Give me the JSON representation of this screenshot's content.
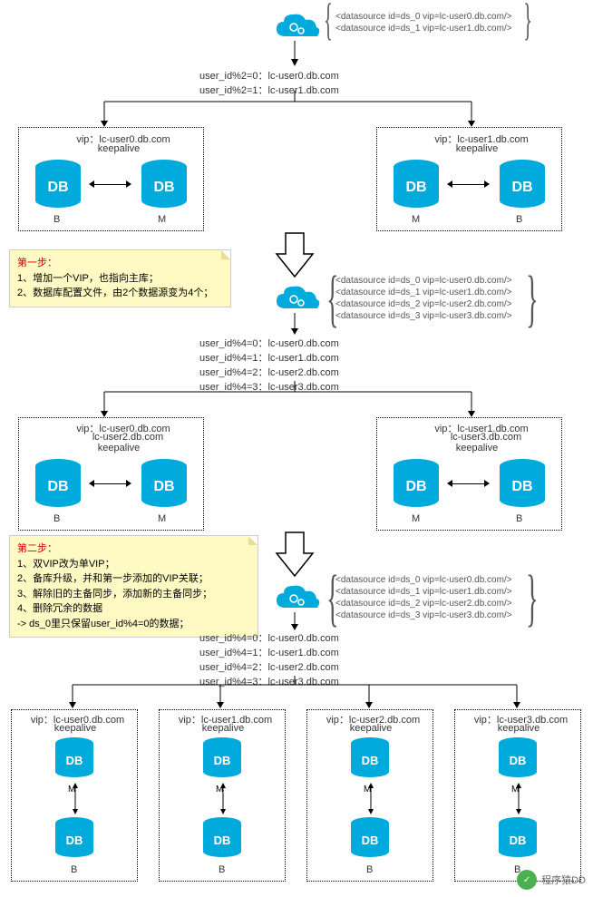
{
  "stage1": {
    "datasources": [
      "<datasource id=ds_0 vip=lc-user0.db.com/>",
      "<datasource id=ds_1 vip=lc-user1.db.com/>"
    ],
    "routing": [
      "user_id%2=0：lc-user0.db.com",
      "user_id%2=1：lc-user1.db.com"
    ],
    "leftBox": {
      "vip": "vip：lc-user0.db.com",
      "keepalive": "keepalive",
      "leftLabel": "B",
      "rightLabel": "M"
    },
    "rightBox": {
      "vip": "vip：lc-user1.db.com",
      "keepalive": "keepalive",
      "leftLabel": "M",
      "rightLabel": "B"
    }
  },
  "note1": {
    "title": "第一步：",
    "lines": [
      "1、增加一个VIP，也指向主库；",
      "2、数据库配置文件，由2个数据源变为4个；"
    ]
  },
  "stage2": {
    "datasources": [
      "<datasource id=ds_0 vip=lc-user0.db.com/>",
      "<datasource id=ds_1 vip=lc-user1.db.com/>",
      "<datasource id=ds_2 vip=lc-user2.db.com/>",
      "<datasource id=ds_3 vip=lc-user3.db.com/>"
    ],
    "routing": [
      "user_id%4=0：lc-user0.db.com",
      "user_id%4=1：lc-user1.db.com",
      "user_id%4=2：lc-user2.db.com",
      "user_id%4=3：lc-user3.db.com"
    ],
    "leftBox": {
      "vip1": "vip：lc-user0.db.com",
      "vip2": "lc-user2.db.com",
      "keepalive": "keepalive",
      "leftLabel": "B",
      "rightLabel": "M"
    },
    "rightBox": {
      "vip1": "vip：lc-user1.db.com",
      "vip2": "lc-user3.db.com",
      "keepalive": "keepalive",
      "leftLabel": "M",
      "rightLabel": "B"
    }
  },
  "note2": {
    "title": "第二步：",
    "lines": [
      "1、双VIP改为单VIP；",
      "2、备库升级，并和第一步添加的VIP关联；",
      "3、解除旧的主备同步，添加新的主备同步；",
      "4、删除冗余的数据",
      "     -> ds_0里只保留user_id%4=0的数据；"
    ]
  },
  "stage3": {
    "datasources": [
      "<datasource id=ds_0 vip=lc-user0.db.com/>",
      "<datasource id=ds_1 vip=lc-user1.db.com/>",
      "<datasource id=ds_2 vip=lc-user2.db.com/>",
      "<datasource id=ds_3 vip=lc-user3.db.com/>"
    ],
    "routing": [
      "user_id%4=0：lc-user0.db.com",
      "user_id%4=1：lc-user1.db.com",
      "user_id%4=2：lc-user2.db.com",
      "user_id%4=3：lc-user3.db.com"
    ],
    "boxes": [
      {
        "vip": "vip：lc-user0.db.com",
        "keepalive": "keepalive",
        "topLabel": "M",
        "bottomLabel": "B"
      },
      {
        "vip": "vip：lc-user1.db.com",
        "keepalive": "keepalive",
        "topLabel": "M",
        "bottomLabel": "B"
      },
      {
        "vip": "vip：lc-user2.db.com",
        "keepalive": "keepalive",
        "topLabel": "M",
        "bottomLabel": "B"
      },
      {
        "vip": "vip：lc-user3.db.com",
        "keepalive": "keepalive",
        "topLabel": "M",
        "bottomLabel": "B"
      }
    ]
  },
  "db_text": "DB",
  "watermark": "程序猿DD"
}
